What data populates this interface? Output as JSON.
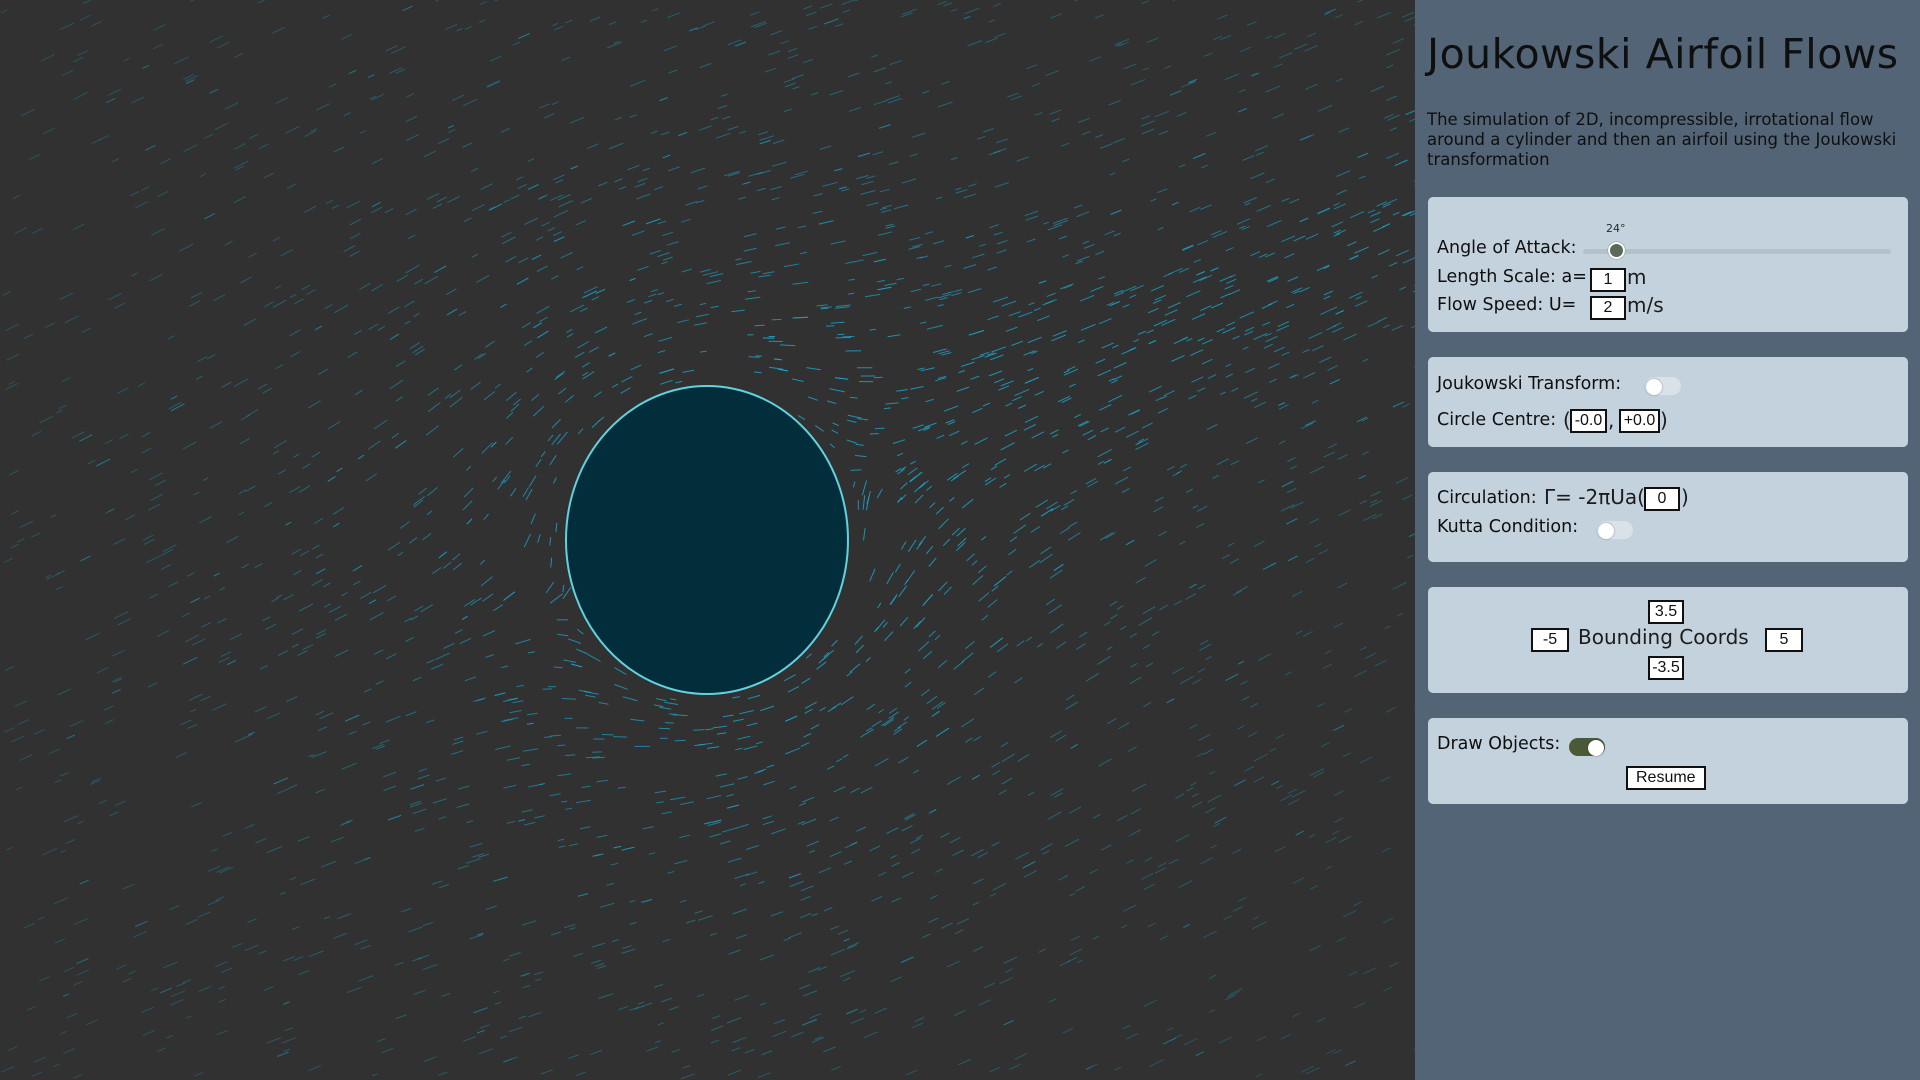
{
  "app": {
    "title": "Joukowski Airfoil Flows",
    "description": "The simulation of 2D, incompressible, irrotational flow around a cylinder and then an airfoil using the Joukowski transformation"
  },
  "controls": {
    "angle_of_attack": {
      "label": "Angle of Attack:",
      "value_text": "24°",
      "value": 24,
      "min": -90,
      "max": 90
    },
    "length_scale": {
      "label": "Length Scale: a=",
      "value": "1",
      "unit": "m"
    },
    "flow_speed": {
      "label": "Flow Speed: U=",
      "value": "2",
      "unit": "m/s"
    }
  },
  "transform": {
    "joukowski_label": "Joukowski Transform:",
    "joukowski_on": false,
    "centre_label": "Circle Centre:",
    "open_paren": "(",
    "comma": ",",
    "close_paren": ")",
    "centre_x": "-0.0",
    "centre_y": "+0.0"
  },
  "circulation": {
    "label": "Circulation:",
    "formula": "Γ= -2πUa(",
    "value": "0",
    "close_paren": ")",
    "kutta_label": "Kutta Condition:",
    "kutta_on": false
  },
  "bounds": {
    "label": "Bounding Coords",
    "top": "3.5",
    "left": "-5",
    "right": "5",
    "bottom": "-3.5"
  },
  "draw": {
    "label": "Draw Objects:",
    "on": true,
    "resume_label": "Resume"
  },
  "colors": {
    "background": "#313131",
    "particles": "#1aa3c8",
    "cylinder_fill": "#022d3a",
    "cylinder_edge": "#5fd3e0",
    "sidebar": "#526475",
    "panel": "#c3d2dc",
    "toggle_on": "#4b5a36"
  }
}
